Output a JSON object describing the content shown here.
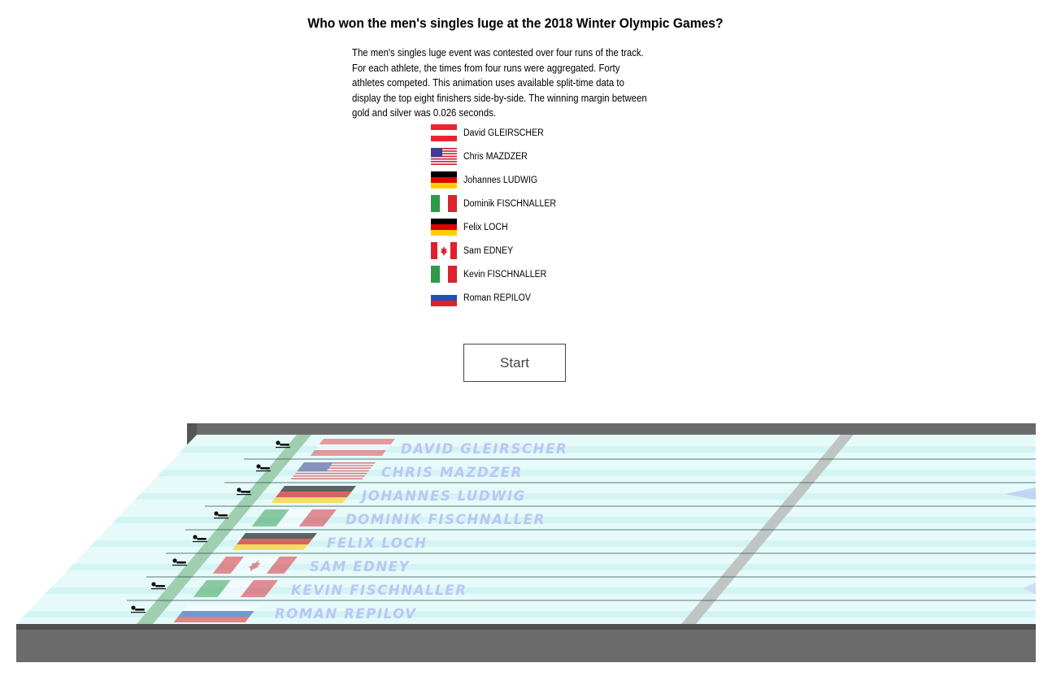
{
  "title": "Who won the men's singles luge at the 2018 Winter Olympic Games?",
  "intro": "The men's singles luge event was contested over four runs of the track. For each athlete, the times from four runs were aggregated. Forty athletes competed. This animation uses available split-time data to display the top eight finishers side-by-side. The winning margin between gold and silver was 0.026 seconds.",
  "athletes": [
    {
      "name": "David GLEIRSCHER",
      "lane_label": "DAVID GLEIRSCHER",
      "country": "Austria",
      "flag_icon": "austria-flag-icon"
    },
    {
      "name": "Chris MAZDZER",
      "lane_label": "CHRIS MAZDZER",
      "country": "United States",
      "flag_icon": "usa-flag-icon"
    },
    {
      "name": "Johannes LUDWIG",
      "lane_label": "JOHANNES LUDWIG",
      "country": "Germany",
      "flag_icon": "germany-flag-icon"
    },
    {
      "name": "Dominik FISCHNALLER",
      "lane_label": "DOMINIK FISCHNALLER",
      "country": "Italy",
      "flag_icon": "italy-flag-icon"
    },
    {
      "name": "Felix LOCH",
      "lane_label": "FELIX LOCH",
      "country": "Germany",
      "flag_icon": "germany-flag-icon"
    },
    {
      "name": "Sam EDNEY",
      "lane_label": "SAM EDNEY",
      "country": "Canada",
      "flag_icon": "canada-flag-icon"
    },
    {
      "name": "Kevin FISCHNALLER",
      "lane_label": "KEVIN FISCHNALLER",
      "country": "Italy",
      "flag_icon": "italy-flag-icon"
    },
    {
      "name": "Roman REPILOV",
      "lane_label": "ROMAN REPILOV",
      "country": "Russia",
      "flag_icon": "russia-flag-icon"
    }
  ],
  "controls": {
    "start_label": "Start"
  },
  "colors": {
    "track_ice": "#e6fafa",
    "track_stripe": "#d2f3f3",
    "wall": "#6b6b6b",
    "start_line": "#9fcfb0",
    "split_line": "#bfc5c3",
    "lane_text": "#b9c6f5"
  }
}
